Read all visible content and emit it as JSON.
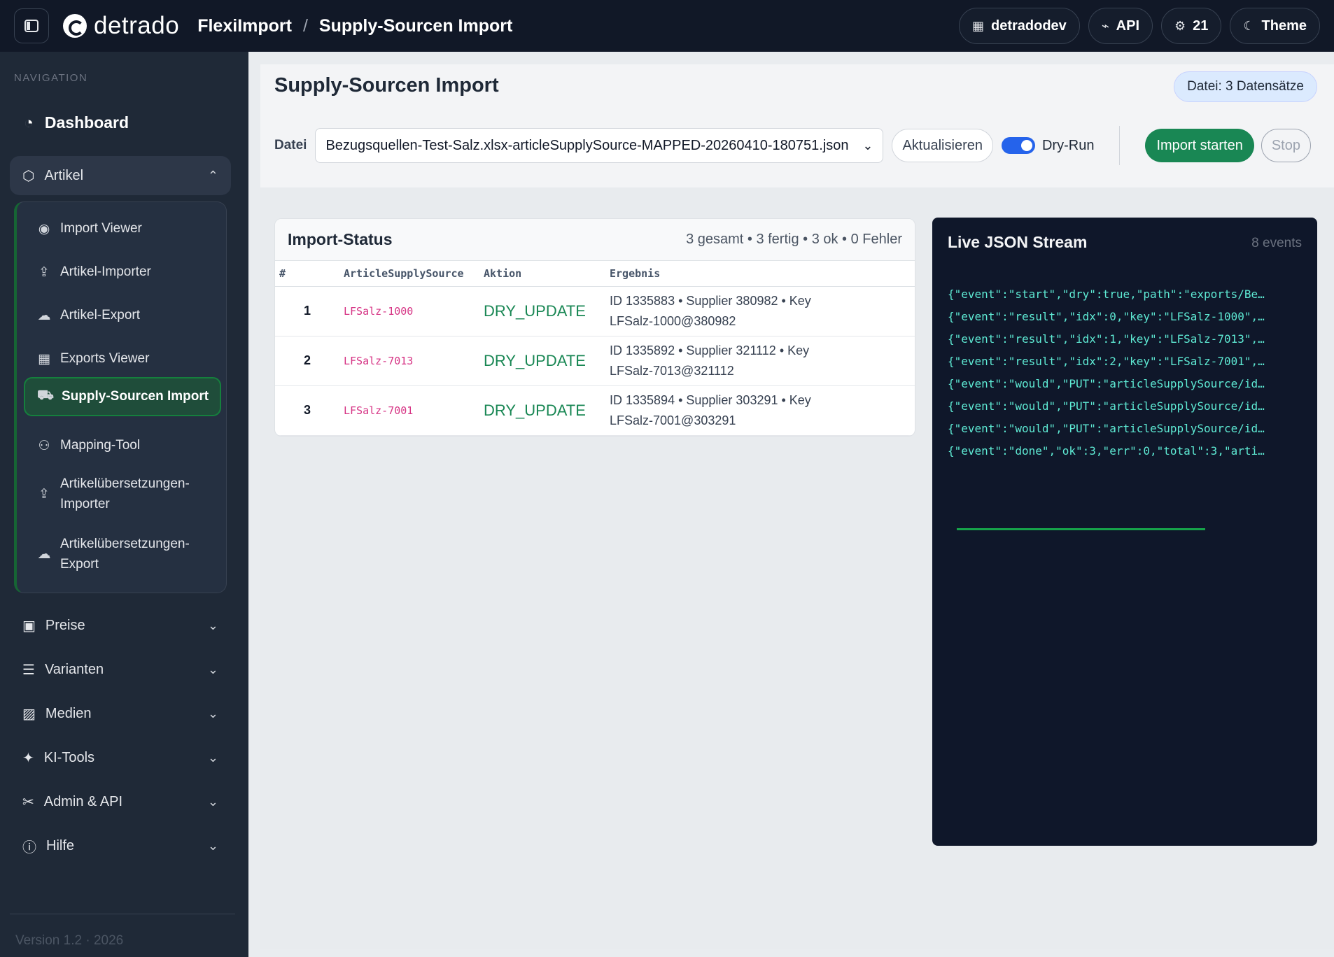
{
  "header": {
    "brand": "detrado",
    "app_name": "FlexiImport",
    "separator": "/",
    "page": "Supply-Sourcen Import",
    "actions": [
      {
        "label": "detradodev",
        "icon": "building-icon"
      },
      {
        "label": "API",
        "icon": "plug-icon"
      },
      {
        "label": "21",
        "icon": "chip-icon"
      },
      {
        "label": "Theme",
        "icon": "moon-icon"
      }
    ]
  },
  "sidebar": {
    "section_title": "NAVIGATION",
    "dashboard": "Dashboard",
    "groups": [
      {
        "label": "Artikel",
        "icon": "box-icon",
        "open": true
      },
      {
        "label": "Preise",
        "icon": "cash-icon"
      },
      {
        "label": "Varianten",
        "icon": "sliders-icon"
      },
      {
        "label": "Medien",
        "icon": "image-icon"
      },
      {
        "label": "KI-Tools",
        "icon": "magic-icon"
      },
      {
        "label": "Admin & API",
        "icon": "tools-icon"
      },
      {
        "label": "Hilfe",
        "icon": "help-icon"
      }
    ],
    "artikel_items": [
      {
        "label": "Import Viewer",
        "icon": "eye-icon"
      },
      {
        "label": "Artikel-Importer",
        "icon": "upload-icon"
      },
      {
        "label": "Artikel-Export",
        "icon": "cloud-download-icon"
      },
      {
        "label": "Exports Viewer",
        "icon": "table-icon"
      },
      {
        "label": "Supply-Sourcen Import",
        "icon": "truck-icon",
        "active": true
      },
      {
        "label": "Mapping-Tool",
        "icon": "diagram-icon"
      },
      {
        "label_line1": "Artikelübersetzungen-",
        "label_line2": "Importer",
        "icon": "upload-icon"
      },
      {
        "label_line1": "Artikelübersetzungen-",
        "label_line2": "Export",
        "icon": "cloud-download-icon"
      }
    ],
    "version": "Version 1.2 · 2026"
  },
  "main": {
    "title": "Supply-Sourcen Import",
    "file_badge": "Datei: 3 Datensätze",
    "file_label": "Datei",
    "file_value": "Bezugsquellen-Test-Salz.xlsx-articleSupplySource-MAPPED-20260410-180751.json",
    "refresh_label": "Aktualisieren",
    "dryrun_label": "Dry-Run",
    "dryrun_on": true,
    "start_label": "Import starten",
    "stop_label": "Stop"
  },
  "status": {
    "title": "Import-Status",
    "summary": "3 gesamt • 3 fertig • 3 ok • 0 Fehler",
    "columns": [
      "#",
      "ArticleSupplySource",
      "Aktion",
      "Ergebnis"
    ],
    "rows": [
      {
        "idx": "1",
        "key": "LFSalz-1000",
        "action": "DRY_UPDATE",
        "result_line1": "ID 1335883 • Supplier 380982 • Key",
        "result_line2": "LFSalz-1000@380982"
      },
      {
        "idx": "2",
        "key": "LFSalz-7013",
        "action": "DRY_UPDATE",
        "result_line1": "ID 1335892 • Supplier 321112 • Key",
        "result_line2": "LFSalz-7013@321112"
      },
      {
        "idx": "3",
        "key": "LFSalz-7001",
        "action": "DRY_UPDATE",
        "result_line1": "ID 1335894 • Supplier 303291 • Key",
        "result_line2": "LFSalz-7001@303291"
      }
    ]
  },
  "stream": {
    "title": "Live JSON Stream",
    "count": "8 events",
    "lines": [
      "{\"event\":\"start\",\"dry\":true,\"path\":\"exports/Be…",
      "{\"event\":\"result\",\"idx\":0,\"key\":\"LFSalz-1000\",…",
      "{\"event\":\"result\",\"idx\":1,\"key\":\"LFSalz-7013\",…",
      "{\"event\":\"result\",\"idx\":2,\"key\":\"LFSalz-7001\",…",
      "{\"event\":\"would\",\"PUT\":\"articleSupplySource/id…",
      "{\"event\":\"would\",\"PUT\":\"articleSupplySource/id…",
      "{\"event\":\"would\",\"PUT\":\"articleSupplySource/id…",
      "{\"event\":\"done\",\"ok\":3,\"err\":0,\"total\":3,\"arti…"
    ]
  }
}
